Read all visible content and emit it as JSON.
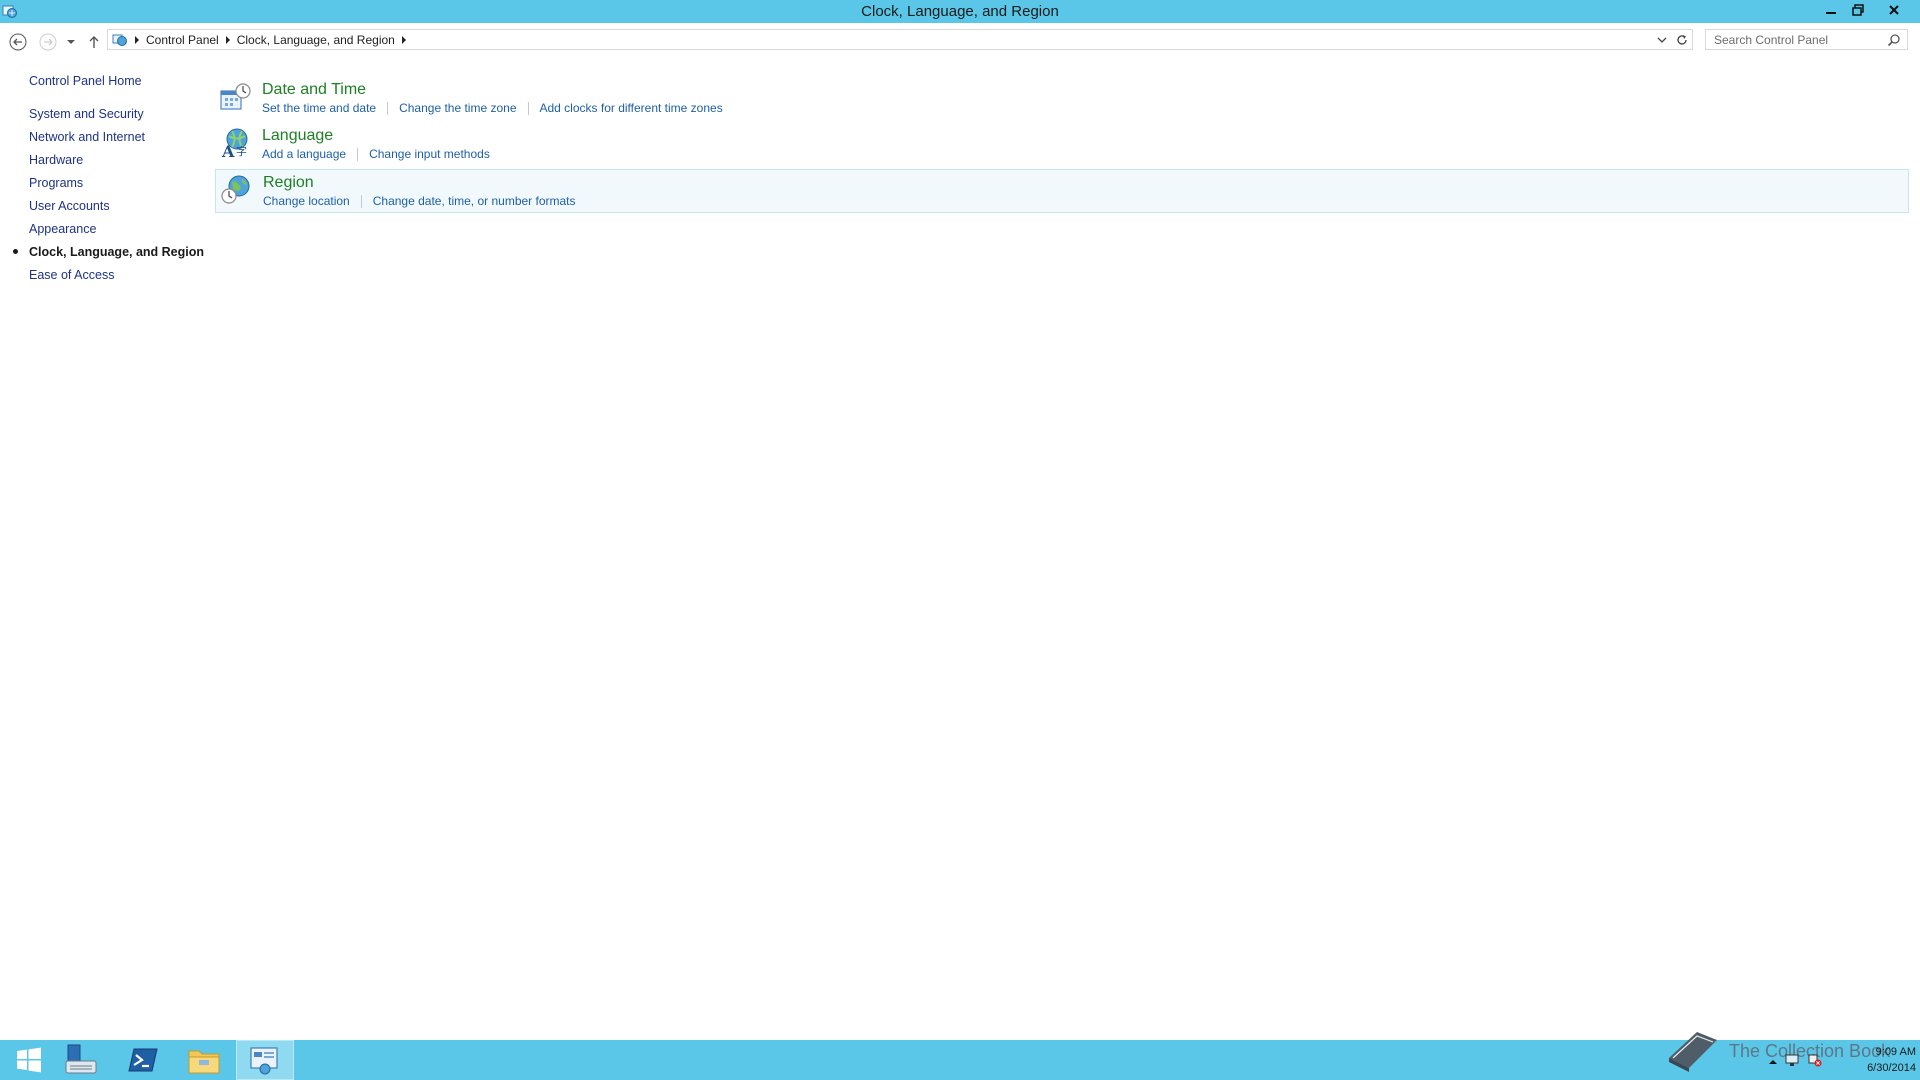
{
  "window": {
    "title": "Clock, Language, and Region"
  },
  "address_bar": {
    "breadcrumbs": [
      "Control Panel",
      "Clock, Language, and Region"
    ]
  },
  "search": {
    "placeholder": "Search Control Panel"
  },
  "left_pane": {
    "home_label": "Control Panel Home",
    "items": [
      {
        "label": "System and Security"
      },
      {
        "label": "Network and Internet"
      },
      {
        "label": "Hardware"
      },
      {
        "label": "Programs"
      },
      {
        "label": "User Accounts"
      },
      {
        "label": "Appearance"
      },
      {
        "label": "Clock, Language, and Region",
        "active": true
      },
      {
        "label": "Ease of Access"
      }
    ]
  },
  "categories": [
    {
      "title": "Date and Time",
      "icon": "date-time-icon",
      "links": [
        "Set the time and date",
        "Change the time zone",
        "Add clocks for different time zones"
      ]
    },
    {
      "title": "Language",
      "icon": "language-icon",
      "links": [
        "Add a language",
        "Change input methods"
      ]
    },
    {
      "title": "Region",
      "icon": "region-icon",
      "links": [
        "Change location",
        "Change date, time, or number formats"
      ],
      "selected": true
    }
  ],
  "taskbar": {
    "apps": [
      "start-icon",
      "server-manager-icon",
      "powershell-icon",
      "file-explorer-icon",
      "control-panel-icon"
    ]
  },
  "watermark": {
    "text": "The Collection Book"
  },
  "clock": {
    "time": "9:09 AM",
    "date": "6/30/2014"
  },
  "colors": {
    "titlebar": "#5bc7e8",
    "category_title": "#1e8025",
    "link": "#1e5fa8",
    "left_link": "#1e3287"
  }
}
